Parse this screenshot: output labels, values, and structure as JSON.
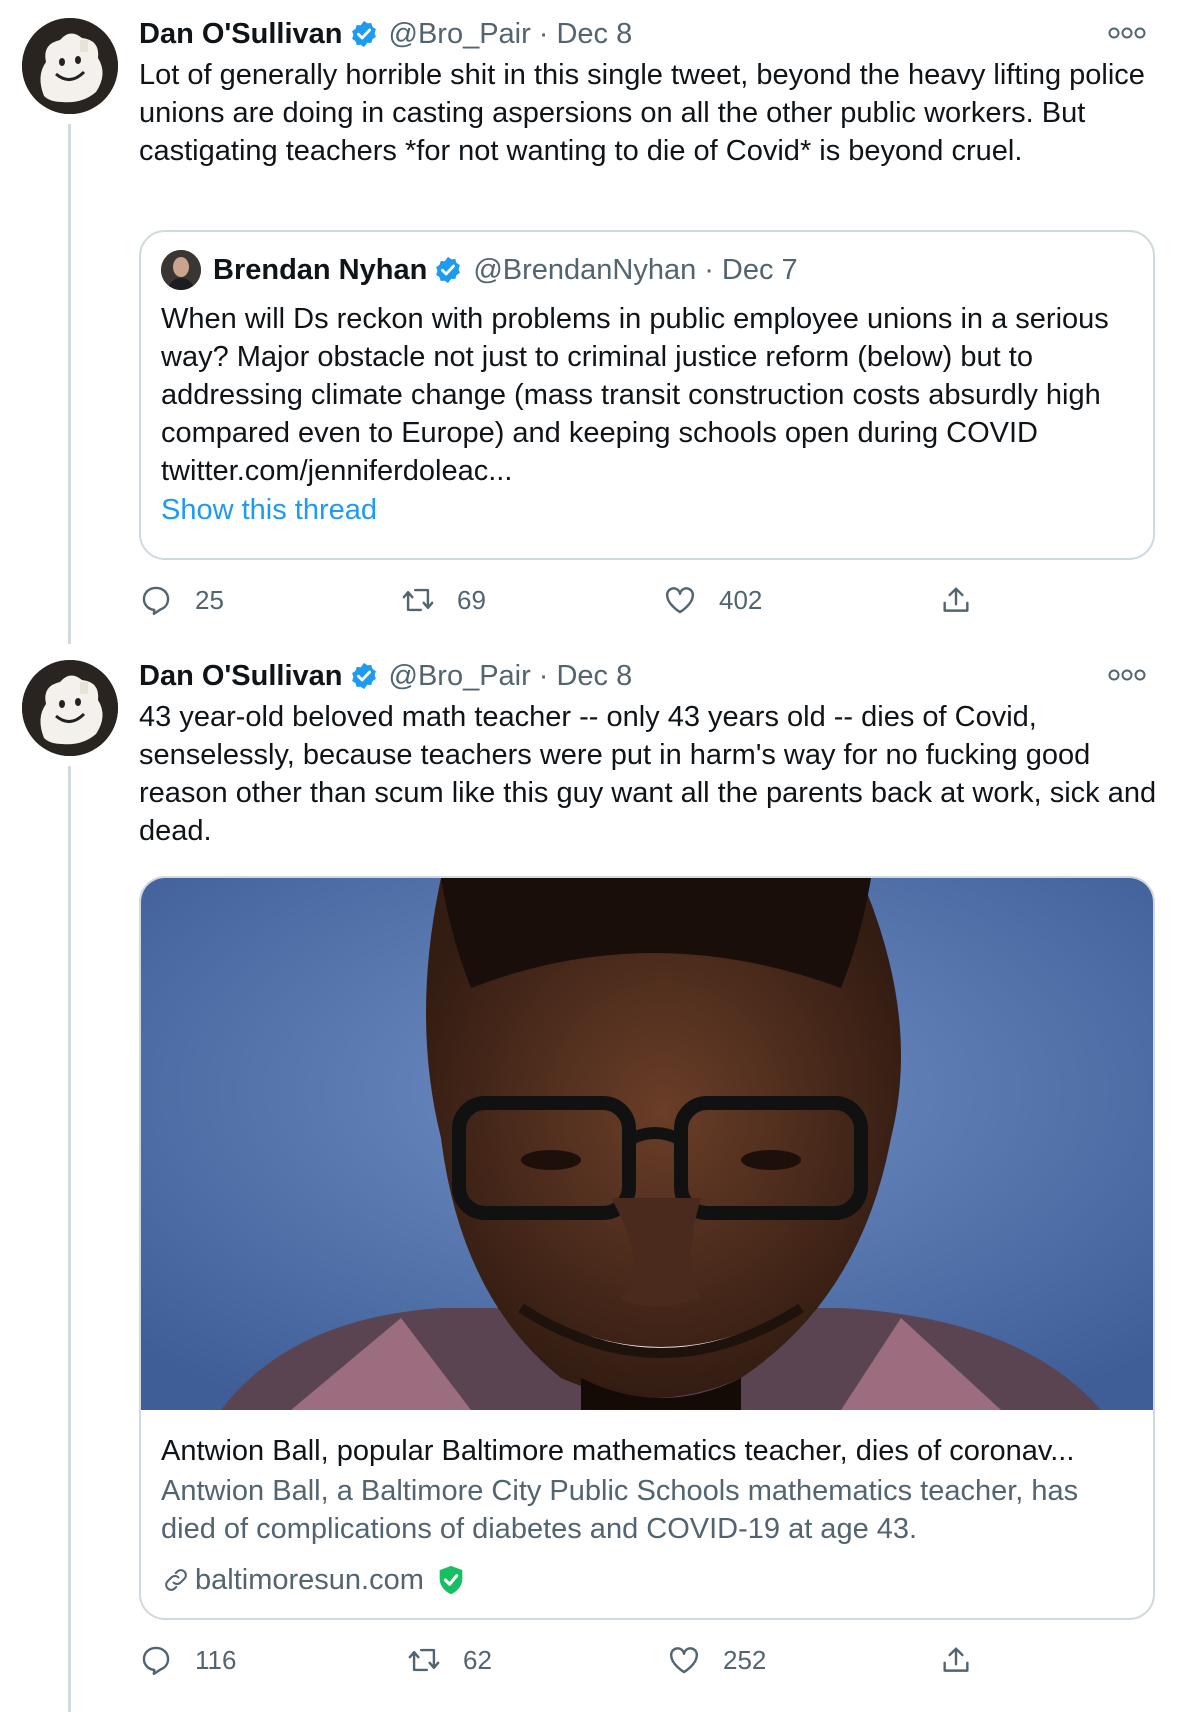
{
  "tweets": [
    {
      "author": {
        "name": "Dan O'Sullivan",
        "handle": "@Bro_Pair",
        "date": "Dec 8"
      },
      "text": "Lot of generally horrible shit in this single tweet, beyond the heavy lifting police unions are doing in casting aspersions on all the other public workers. But castigating teachers *for not wanting to die of Covid* is beyond cruel.",
      "quote": {
        "author": {
          "name": "Brendan Nyhan",
          "handle": "@BrendanNyhan",
          "date": "Dec 7"
        },
        "text": "When will Ds reckon with problems in public employee unions in a serious way? Major obstacle not just to criminal justice reform (below) but to addressing climate change (mass transit construction costs absurdly high compared even to Europe) and keeping schools open during COVID twitter.com/jenniferdoleac...",
        "show_thread": "Show this thread"
      },
      "stats": {
        "replies": "25",
        "retweets": "69",
        "likes": "402"
      }
    },
    {
      "author": {
        "name": "Dan O'Sullivan",
        "handle": "@Bro_Pair",
        "date": "Dec 8"
      },
      "text": "43 year-old beloved math teacher -- only 43 years old -- dies of Covid, senselessly, because teachers were put in harm's way for no fucking good reason other than scum like this guy want all the parents back at work, sick and dead.",
      "link_card": {
        "title": "Antwion Ball, popular Baltimore mathematics teacher, dies of coronav...",
        "description": "Antwion Ball, a Baltimore City Public Schools mathematics teacher, has died of complications of diabetes and COVID-19 at age 43.",
        "domain": "baltimoresun.com"
      },
      "stats": {
        "replies": "116",
        "retweets": "62",
        "likes": "252"
      }
    }
  ],
  "separator": "·",
  "colors": {
    "verified": "#1d9bf0",
    "link": "#1d9bf0",
    "secondary": "#536471",
    "border": "#cfd9de",
    "safe_badge": "#17bf63"
  },
  "icons": [
    "verified-badge-icon",
    "more-icon",
    "reply-icon",
    "retweet-icon",
    "like-icon",
    "share-icon",
    "link-icon",
    "shield-check-icon"
  ]
}
